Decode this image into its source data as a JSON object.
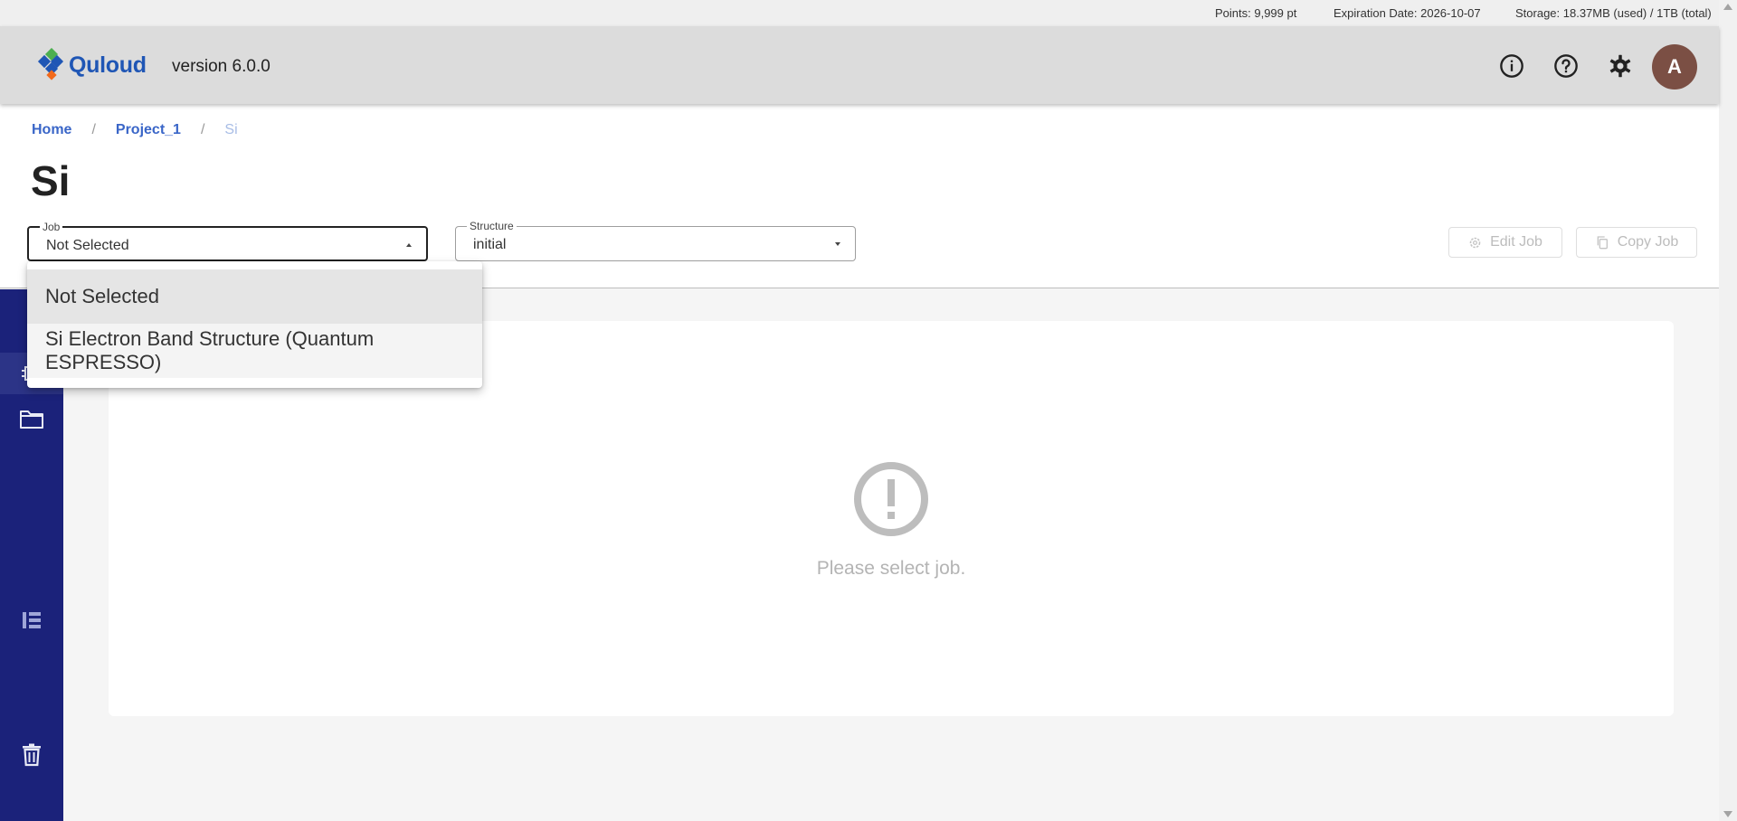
{
  "status_bar": {
    "points": "Points: 9,999 pt",
    "expiration": "Expiration Date: 2026-10-07",
    "storage": "Storage: 18.37MB (used) / 1TB (total)"
  },
  "header": {
    "brand": "Quloud",
    "version": "version 6.0.0",
    "avatar_initial": "A",
    "icons": [
      "info-icon",
      "help-icon",
      "gear-icon"
    ]
  },
  "breadcrumb": {
    "items": [
      "Home",
      "Project_1"
    ],
    "separator": "/",
    "current": "Si"
  },
  "page_title": "Si",
  "job_select": {
    "label": "Job",
    "value": "Not Selected",
    "options": [
      "Not Selected",
      "Si Electron Band Structure (Quantum ESPRESSO)"
    ]
  },
  "structure_select": {
    "label": "Structure",
    "value": "initial"
  },
  "actions": {
    "edit_job": "Edit Job",
    "copy_job": "Copy Job"
  },
  "sidebar": {
    "icons": [
      "list-icon",
      "folder-icon",
      "trash-icon"
    ]
  },
  "main": {
    "empty_message": "Please select job."
  },
  "colors": {
    "brand_blue": "#1f56b5",
    "sidebar": "#1b227a",
    "avatar": "#7b4f44",
    "link": "#3a66c8"
  }
}
